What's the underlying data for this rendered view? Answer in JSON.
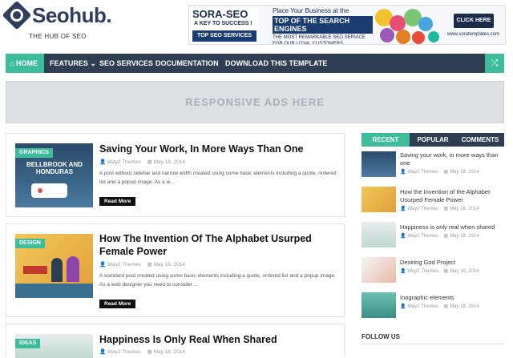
{
  "site": {
    "name": "Seohub.",
    "tagline": "THE HUB OF SEO"
  },
  "banner": {
    "brand": "SORA-SEO",
    "brand_sub": "A KEY TO SUCCESS !",
    "brand_badge": "TOP SEO SERVICES",
    "line1": "Place Your Business at the",
    "line2": "TOP OF THE SEARCH ENGINES",
    "line3": "THE MOST REMARKABLE SEO SERVICE FOR OUR LOYAL CUSTOMERS",
    "cta": "CLICK HERE",
    "url": "www.soratemplates.com"
  },
  "nav": {
    "items": [
      "HOME",
      "FEATURES",
      "SEO SERVICES",
      "DOCUMENTATION",
      "DOWNLOAD THIS TEMPLATE"
    ],
    "features_caret": "⌄",
    "shuffle_icon": "⤮"
  },
  "ads": {
    "text": "RESPONSIVE ADS HERE"
  },
  "posts": [
    {
      "label": "GRAPHICS",
      "title": "Saving Your Work, In More Ways Than One",
      "author": "Way2 Themes",
      "date": "May 18, 2014",
      "excerpt": "A post without sidebar and narrow width created using some basic elements including a quote, ordered list and a popup image. As a w...",
      "read_more": "Read More",
      "thumb_text": "BELLBROOK AND HONDURAS"
    },
    {
      "label": "DESIGN",
      "title": "How The Invention Of The Alphabet Usurped Female Power",
      "author": "Way2 Themes",
      "date": "May 18, 2014",
      "excerpt": "A standard post created using some basic elements including a quote, ordered list and a popup image. As a web designer you need to consider ...",
      "read_more": "Read More"
    },
    {
      "label": "IDEAS",
      "title": "Happiness Is Only Real When Shared",
      "author": "Way2 Themes",
      "date": "May 18, 2014"
    }
  ],
  "sidebar": {
    "tabs": [
      "RECENT",
      "POPULAR",
      "COMMENTS"
    ],
    "items": [
      {
        "title": "Saving your work, in more ways than one",
        "author": "Way2 Themes",
        "date": "May 18, 2014"
      },
      {
        "title": "How the Invention of the Alphabet Usurped Female Power",
        "author": "Way2 Themes",
        "date": "May 18, 2014"
      },
      {
        "title": "Happiness is only real when shared",
        "author": "Way2 Themes",
        "date": "May 18, 2014"
      },
      {
        "title": "Desiring God Project",
        "author": "Way2 Themes",
        "date": "May 18, 2014"
      },
      {
        "title": "Inographic elements",
        "author": "Way2 Themes",
        "date": "May 18, 2014"
      }
    ],
    "follow_us": "FOLLOW US"
  },
  "colors": {
    "accent": "#3dbd9a",
    "nav_bg": "#2f3e52",
    "brand": "#2f3e5c"
  }
}
